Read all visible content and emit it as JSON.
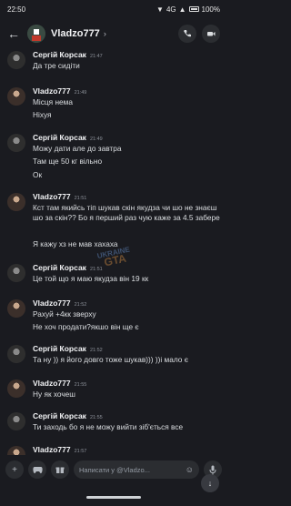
{
  "status": {
    "time": "22:50",
    "network": "4G",
    "battery": "100%"
  },
  "header": {
    "title": "Vladzo777"
  },
  "messages": [
    {
      "author": "Сергій Корсак",
      "time": "21:47",
      "avatar": "korsak",
      "lines": [
        "Да тре сидіти"
      ]
    },
    {
      "author": "Vladzo777",
      "time": "21:49",
      "avatar": "vladzo",
      "lines": [
        "Місця нема",
        "Ніхуя"
      ]
    },
    {
      "author": "Сергій Корсак",
      "time": "21:49",
      "avatar": "korsak",
      "lines": [
        "Можу дати але до завтра",
        "Там ще 50 кг вільно",
        "Ок"
      ]
    },
    {
      "author": "Vladzo777",
      "time": "21:51",
      "avatar": "vladzo",
      "paragraph": "Кст там якийсь тіп шукав скін якудза чи шо не знаєш шо за скін?? Бо я перший раз чую каже за 4.5 забере",
      "lines": [
        "Я кажу хз не мав хахаха"
      ]
    },
    {
      "author": "Сергій Корсак",
      "time": "21:51",
      "avatar": "korsak",
      "lines": [
        "Це той що я маю якудза він 19 кк"
      ]
    },
    {
      "author": "Vladzo777",
      "time": "21:52",
      "avatar": "vladzo",
      "lines": [
        "Рахуй +4кк зверху",
        "Не хоч продати?якшо він ще є"
      ]
    },
    {
      "author": "Сергій Корсак",
      "time": "21:52",
      "avatar": "korsak",
      "lines": [
        "Та ну )) я його довго тоже шукав))) ))і мало є"
      ]
    },
    {
      "author": "Vladzo777",
      "time": "21:55",
      "avatar": "vladzo",
      "lines": [
        "Ну як хочеш"
      ]
    },
    {
      "author": "Сергій Корсак",
      "time": "21:55",
      "avatar": "korsak",
      "lines": [
        "Ти заходь бо я не можу вийти зіб'ється все"
      ]
    },
    {
      "author": "Vladzo777",
      "time": "21:57",
      "avatar": "vladzo",
      "lines": []
    }
  ],
  "watermark": {
    "top": "UKRAINE",
    "bottom": "GTA"
  },
  "composer": {
    "placeholder": "Написати у @Vladzo..."
  },
  "icons": {
    "back": "arrow-left-icon",
    "call": "phone-icon",
    "video": "video-camera-icon",
    "add": "plus-icon",
    "games": "gamepad-icon",
    "gift": "gift-icon",
    "emoji": "smiley-icon",
    "mic": "microphone-icon",
    "scroll": "arrow-down-icon"
  },
  "colors": {
    "background": "#1a1b20",
    "surface": "#2b2d31",
    "text": "#dbdee1"
  }
}
